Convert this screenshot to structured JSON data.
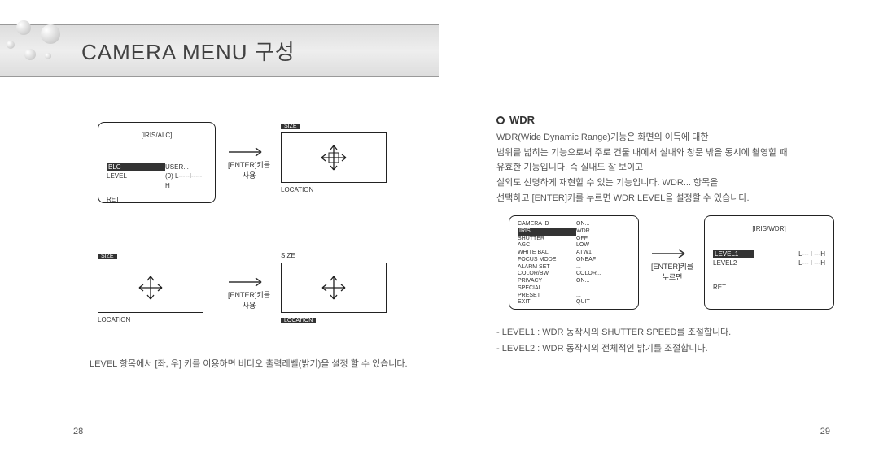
{
  "header": {
    "title": "CAMERA MENU 구성"
  },
  "left": {
    "box1": {
      "title": "IRIS/ALC",
      "rows": [
        {
          "k": "BLC",
          "v": "USER..."
        },
        {
          "k": "LEVEL",
          "v": "(0) L-----I-----H"
        }
      ],
      "ret": "RET"
    },
    "arrow1": {
      "label1": "[ENTER]키를",
      "label2": "사용"
    },
    "sizebox_tr": {
      "head": "SIZE",
      "foot": "LOCATION"
    },
    "sizebox_bl": {
      "head": "SIZE",
      "foot": "LOCATION"
    },
    "arrow2": {
      "label1": "[ENTER]키를",
      "label2": "사용"
    },
    "sizebox_br": {
      "head": "SIZE",
      "foot": "LOCATION"
    },
    "caption": "LEVEL 항목에서 [좌, 우] 키를 이용하면 비디오 출력레벨(밝기)을 설정 할 수 있습니다."
  },
  "right": {
    "section": "WDR",
    "desc": [
      "WDR(Wide Dynamic Range)기능은 화면의 이득에 대한",
      "범위를 넓히는 기능으로써 주로 건물 내에서 실내와 창문 밖을 동시에 촬영할 때",
      "유효한 기능입니다. 즉 실내도 잘 보이고",
      "실외도 선명하게 재현할 수 있는 기능입니다. WDR... 항목을",
      "선택하고 [ENTER]키를 누르면 WDR LEVEL을 설정할 수 있습니다."
    ],
    "menu": {
      "rows": [
        {
          "k": "CAMERA ID",
          "v": "ON..."
        },
        {
          "k": "IRIS",
          "v": "WDR..."
        },
        {
          "k": "SHUTTER",
          "v": "OFF"
        },
        {
          "k": "AGC",
          "v": "LOW"
        },
        {
          "k": "WHITE BAL",
          "v": "ATW1"
        },
        {
          "k": "FOCUS MODE",
          "v": "ONEAF"
        },
        {
          "k": "ALARM SET",
          "v": "..."
        },
        {
          "k": "COLOR/BW",
          "v": "COLOR..."
        },
        {
          "k": "PRIVACY",
          "v": "ON..."
        },
        {
          "k": "SPECIAL",
          "v": "..."
        },
        {
          "k": "PRESET",
          "v": "..."
        },
        {
          "k": "EXIT",
          "v": "QUIT"
        }
      ]
    },
    "arrow": {
      "label1": "[ENTER]키를",
      "label2": "누르면"
    },
    "wdrbox": {
      "title": "IRIS/WDR",
      "rows": [
        {
          "k": "LEVEL1",
          "v": "L--- I ---H"
        },
        {
          "k": "LEVEL2",
          "v": "L--- I ---H"
        }
      ],
      "ret": "RET"
    },
    "levels": [
      "-  LEVEL1 : WDR 동작시의 SHUTTER SPEED를 조절합니다.",
      "-  LEVEL2 : WDR 동작시의 전체적인 밝기를 조절합니다."
    ]
  },
  "pages": {
    "left": "28",
    "right": "29"
  }
}
